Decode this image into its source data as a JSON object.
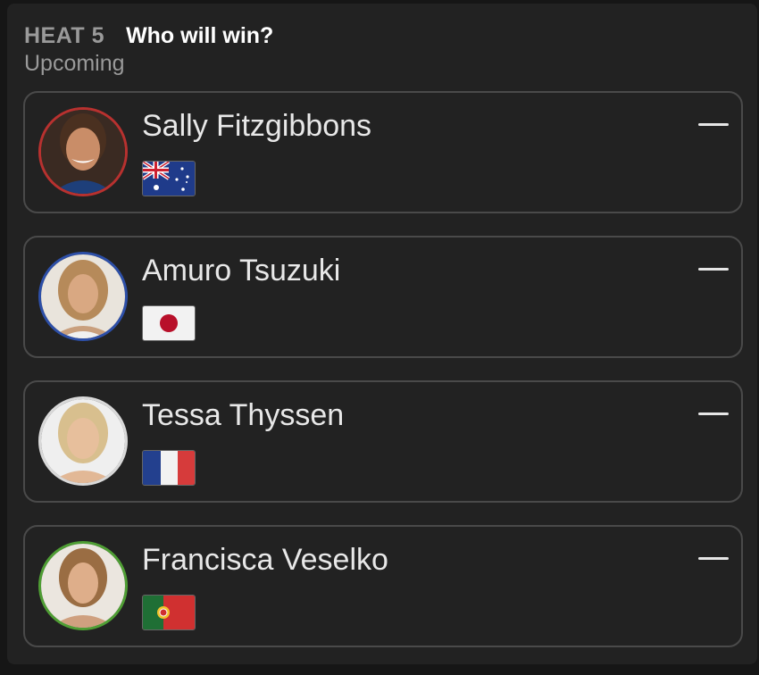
{
  "header": {
    "heat_label": "HEAT 5",
    "question": "Who will win?",
    "status": "Upcoming"
  },
  "surfers": [
    {
      "name": "Sally Fitzgibbons",
      "country_flag": "australia-flag",
      "ring_color": "#b8312f",
      "pick": "—"
    },
    {
      "name": "Amuro Tsuzuki",
      "country_flag": "japan-flag",
      "ring_color": "#2d4fa8",
      "pick": "—"
    },
    {
      "name": "Tessa Thyssen",
      "country_flag": "france-flag",
      "ring_color": "#d9d9d9",
      "pick": "—"
    },
    {
      "name": "Francisca Veselko",
      "country_flag": "portugal-flag",
      "ring_color": "#4f9e34",
      "pick": "—"
    }
  ]
}
